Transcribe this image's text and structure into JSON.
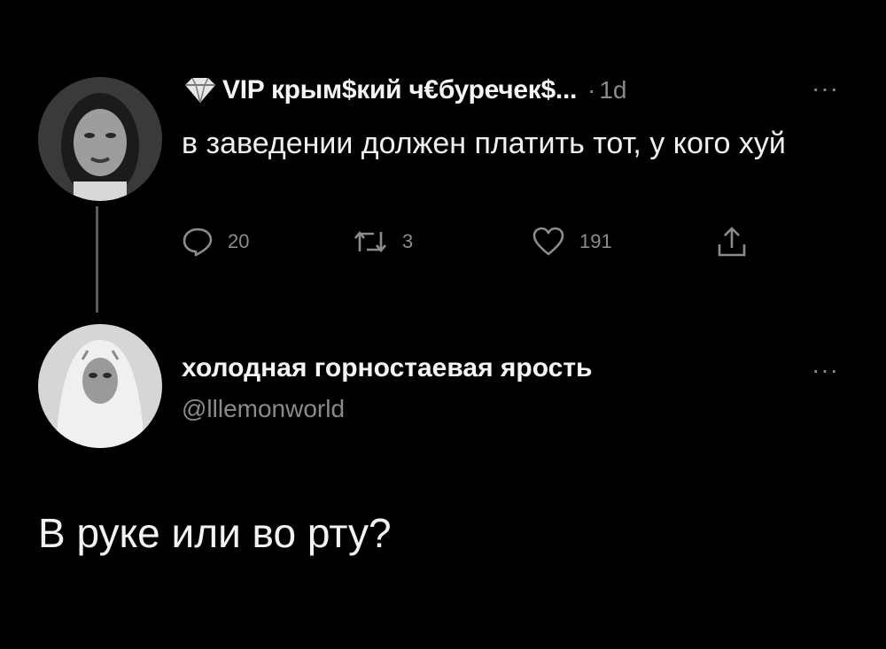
{
  "colors": {
    "background": "#000000",
    "text_primary": "#f2f2f2",
    "text_secondary": "#8a8a8a",
    "thread_line": "#5b5b5b"
  },
  "tweet_1": {
    "avatar_icon": "user-avatar-photo",
    "badge_icon": "diamond-icon",
    "author_name": "VIP крым$кий ч€буречек$...",
    "separator": "·",
    "time": "1d",
    "more": "···",
    "text": "в заведении должен платить тот, у кого хуй",
    "actions": {
      "reply": {
        "icon": "reply-icon",
        "count": "20"
      },
      "retweet": {
        "icon": "retweet-icon",
        "count": "3"
      },
      "like": {
        "icon": "heart-icon",
        "count": "191"
      },
      "share": {
        "icon": "share-icon"
      }
    }
  },
  "tweet_2": {
    "avatar_icon": "user-avatar-photo",
    "author_name": "холодная горностаевая ярость",
    "handle": "@lllemonworld",
    "more": "···",
    "text": "В руке или во рту?"
  }
}
